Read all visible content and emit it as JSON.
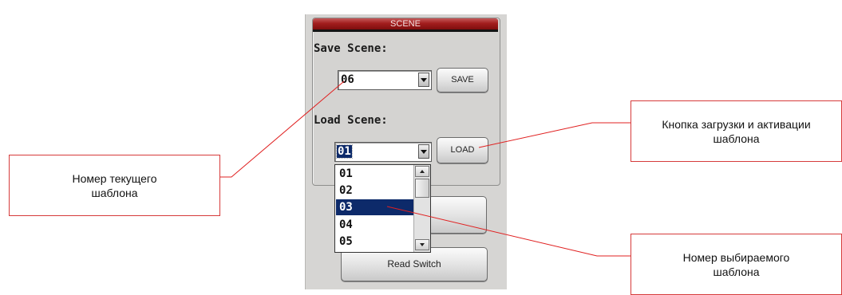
{
  "panel": {
    "header": "SCENE",
    "save_label": "Save Scene:",
    "save_value": "06",
    "save_button": "SAVE",
    "load_label": "Load Scene:",
    "load_value": "01",
    "load_button": "LOAD",
    "read_switch_button": "Read Switch"
  },
  "dropdown": {
    "options": [
      "01",
      "02",
      "03",
      "04",
      "05"
    ],
    "selected": "03"
  },
  "callouts": {
    "current_template": "Номер текущего шаблона",
    "load_button_desc": "Кнопка загрузки и активации шаблона",
    "selected_template": "Номер выбираемого шаблона"
  },
  "colors": {
    "header_red": "#a31e1e",
    "selection_navy": "#0d2a6a",
    "callout_line": "#e02020"
  }
}
